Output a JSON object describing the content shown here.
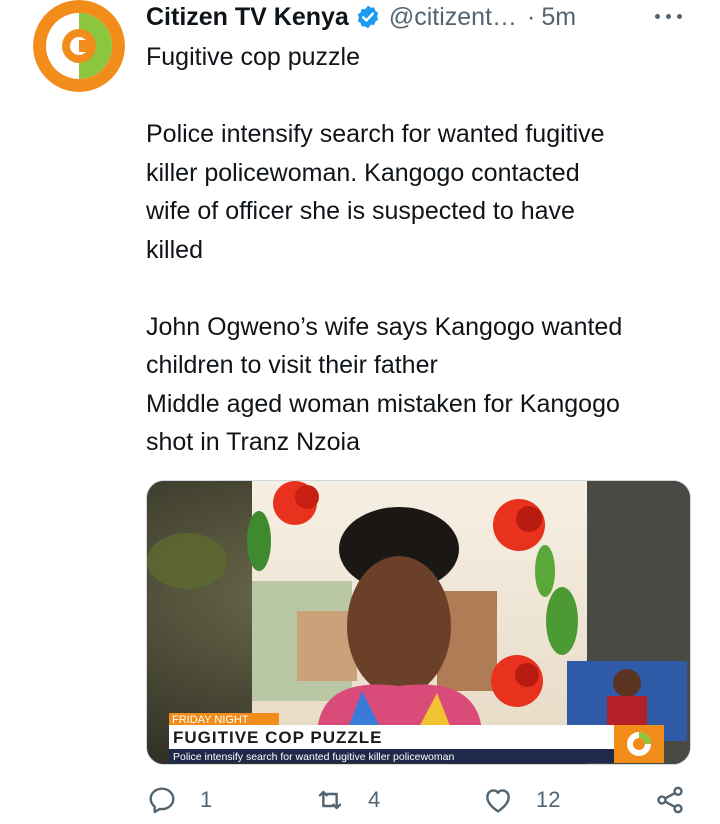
{
  "tweet": {
    "author_name": "Citizen TV Kenya",
    "handle": "@citizent…",
    "separator": "·",
    "time": "5m",
    "lines": [
      "Fugitive cop puzzle",
      "",
      "Police intensify search for wanted fugitive",
      "killer policewoman. Kangogo contacted",
      "wife of officer she is suspected to have",
      "killed",
      "",
      "John Ogweno’s wife says Kangogo wanted",
      "children to visit their father",
      "Middle aged woman mistaken for Kangogo",
      "shot in Tranz Nzoia"
    ]
  },
  "media": {
    "tag": "FRIDAY NIGHT",
    "headline": "FUGITIVE COP PUZZLE",
    "ticker": "Police intensify search for wanted fugitive killer policewoman"
  },
  "actions": {
    "reply_count": "1",
    "retweet_count": "4",
    "like_count": "12"
  },
  "colors": {
    "brand_orange": "#f28c1a",
    "brand_green": "#8cc63f",
    "verified_blue": "#1d9bf0",
    "muted_text": "#536471"
  }
}
